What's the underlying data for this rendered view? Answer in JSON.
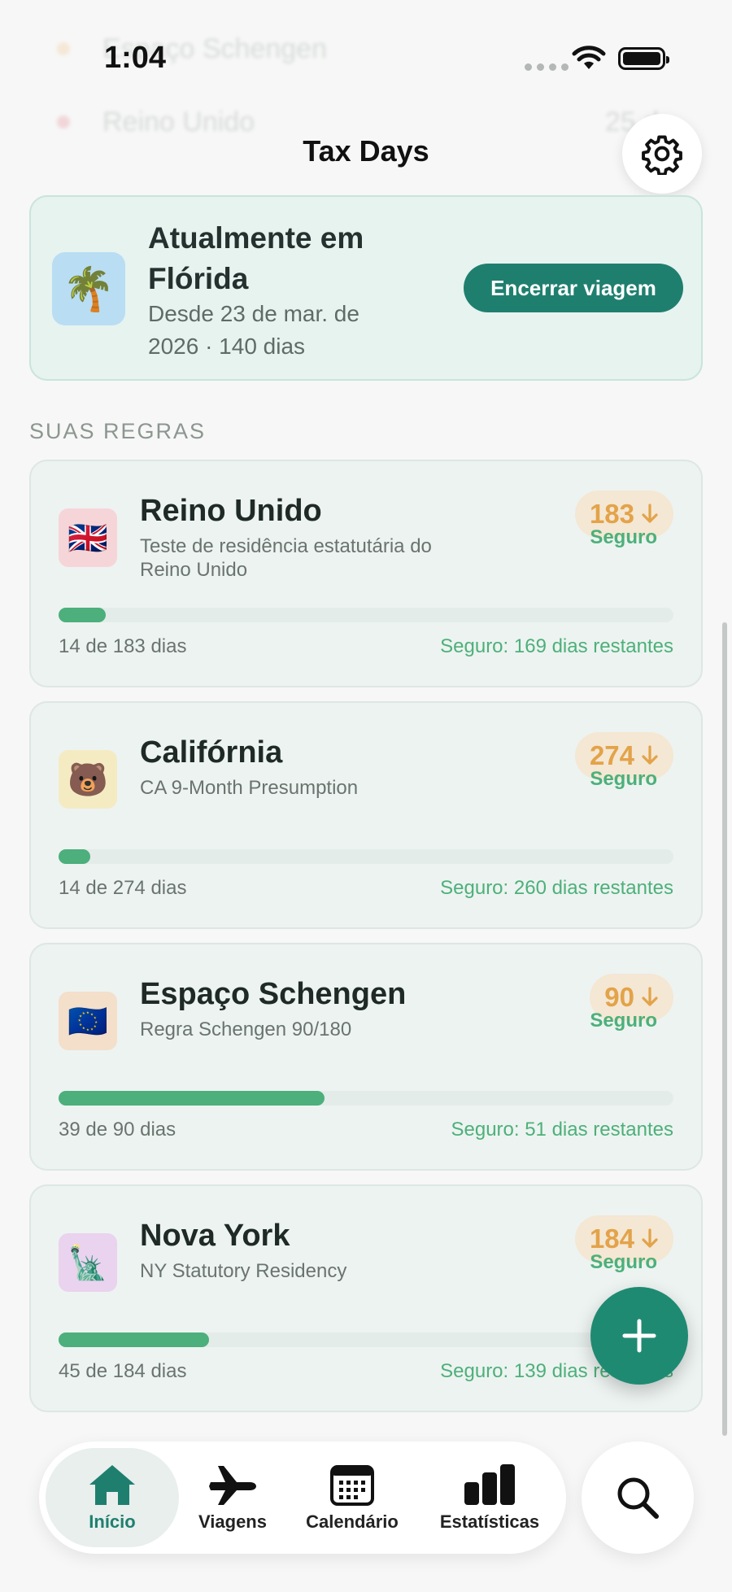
{
  "status_bar": {
    "time": "1:04"
  },
  "background_rows": [
    {
      "label": "Espaço Schengen",
      "color": "#f0a34a"
    },
    {
      "label": "Reino Unido",
      "value": "25 d",
      "color": "#e0455a"
    }
  ],
  "header": {
    "title": "Tax Days",
    "settings_icon": "gear-icon"
  },
  "current_trip": {
    "icon": "🌴",
    "title": "Atualmente em Flórida",
    "subtitle": "Desde 23 de mar. de 2026 · 140 dias",
    "end_button": "Encerrar viagem"
  },
  "rules_section_label": "SUAS REGRAS",
  "rules": [
    {
      "icon": "🇬🇧",
      "icon_bg": "#f6d5d8",
      "name": "Reino Unido",
      "description": "Teste de residência estatutária do Reino Unido",
      "limit": "183",
      "status": "Seguro",
      "progress": 0.077,
      "count": "14 de 183 dias",
      "remaining": "Seguro: 169 dias restantes"
    },
    {
      "icon": "🐻",
      "icon_bg": "#f5ebc3",
      "name": "Califórnia",
      "description": "CA 9-Month Presumption",
      "limit": "274",
      "status": "Seguro",
      "progress": 0.051,
      "count": "14 de 274 dias",
      "remaining": "Seguro: 260 dias restantes"
    },
    {
      "icon": "🇪🇺",
      "icon_bg": "#f4dfcb",
      "name": "Espaço Schengen",
      "description": "Regra Schengen 90/180",
      "limit": "90",
      "status": "Seguro",
      "progress": 0.433,
      "count": "39 de 90 dias",
      "remaining": "Seguro: 51 dias restantes"
    },
    {
      "icon": "🗽",
      "icon_bg": "#ead3ee",
      "name": "Nova York",
      "description": "NY Statutory Residency",
      "limit": "184",
      "status": "Seguro",
      "progress": 0.245,
      "count": "45 de 184 dias",
      "remaining": "Seguro: 139 dias restantes"
    }
  ],
  "fab": {
    "icon": "plus-icon"
  },
  "tabs": [
    {
      "label": "Início",
      "icon": "home-icon",
      "active": true
    },
    {
      "label": "Viagens",
      "icon": "airplane-icon",
      "active": false
    },
    {
      "label": "Calendário",
      "icon": "calendar-icon",
      "active": false
    },
    {
      "label": "Estatísticas",
      "icon": "bar-chart-icon",
      "active": false
    }
  ],
  "colors": {
    "accent": "#1f7f6f",
    "safe": "#4db07a",
    "limit": "#e3a34a"
  }
}
